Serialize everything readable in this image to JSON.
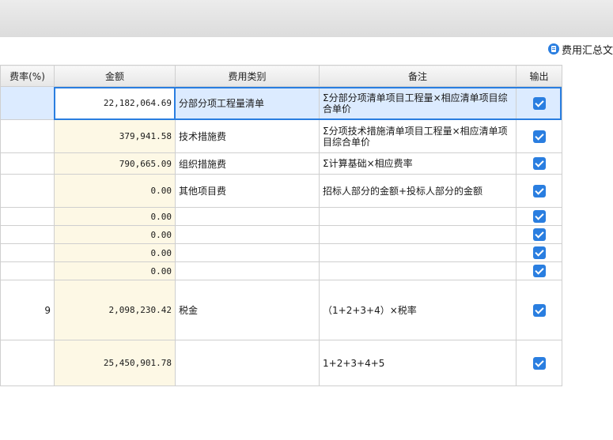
{
  "toolbar": {
    "summary_label": "费用汇总文"
  },
  "columns": {
    "rate": "费率(%)",
    "amount": "金额",
    "category": "费用类别",
    "note": "备注",
    "output": "输出"
  },
  "rows": [
    {
      "rate": "",
      "amount": "22,182,064.69",
      "category": "分部分项工程量清单",
      "note": "Σ分部分项清单项目工程量×相应清单项目综合单价",
      "output": true
    },
    {
      "rate": "",
      "amount": "379,941.58",
      "category": "技术措施费",
      "note": "Σ分项技术措施清单项目工程量×相应清单项目综合单价",
      "output": true
    },
    {
      "rate": "",
      "amount": "790,665.09",
      "category": "组织措施费",
      "note": "Σ计算基础×相应费率",
      "output": true
    },
    {
      "rate": "",
      "amount": "0.00",
      "category": "其他项目费",
      "note": "招标人部分的金额+投标人部分的金额",
      "output": true
    },
    {
      "rate": "",
      "amount": "0.00",
      "category": "",
      "note": "",
      "output": true
    },
    {
      "rate": "",
      "amount": "0.00",
      "category": "",
      "note": "",
      "output": true
    },
    {
      "rate": "",
      "amount": "0.00",
      "category": "",
      "note": "",
      "output": true
    },
    {
      "rate": "",
      "amount": "0.00",
      "category": "",
      "note": "",
      "output": true
    },
    {
      "rate": "9",
      "amount": "2,098,230.42",
      "category": "税金",
      "note": "（1+2+3+4）×税率",
      "output": true
    },
    {
      "rate": "",
      "amount": "25,450,901.78",
      "category": "",
      "note": "1+2+3+4+5",
      "output": true
    }
  ]
}
